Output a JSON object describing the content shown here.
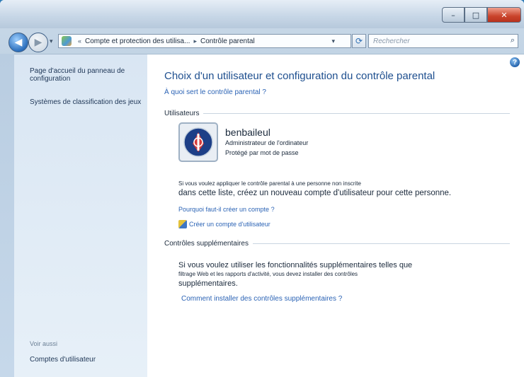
{
  "address": {
    "crumb1": "Compte et protection des utilisa...",
    "crumb2": "Contrôle parental"
  },
  "search": {
    "placeholder": "Rechercher"
  },
  "sidebar": {
    "link1": "Page d'accueil du panneau de configuration",
    "link2": "Systèmes de classification des jeux",
    "see_also": "Voir aussi",
    "accounts": "Comptes d'utilisateur"
  },
  "main": {
    "title": "Choix d'un utilisateur et configuration du contrôle parental",
    "what_link": "À quoi sert le contrôle parental ?",
    "users_header": "Utilisateurs",
    "user": {
      "name": "benbaileul",
      "role": "Administrateur de l'ordinateur",
      "protection": "Protégé par mot de passe"
    },
    "add_small": "Si vous voulez appliquer le contrôle parental à une personne non inscrite",
    "add_large": "dans cette liste, créez un nouveau compte d'utilisateur pour cette personne.",
    "why_link": "Pourquoi faut-il créer un compte ?",
    "create_link": "Créer un compte d'utilisateur",
    "extra_header": "Contrôles supplémentaires",
    "extra_line1": "Si vous voulez utiliser les fonctionnalités supplémentaires telles que",
    "extra_line2": "filtrage Web et les rapports d'activité, vous devez installer des contrôles",
    "extra_line3": "supplémentaires.",
    "extra_link": "Comment installer des contrôles supplémentaires ?"
  },
  "icons": {
    "back": "back-arrow-icon",
    "forward": "forward-arrow-icon",
    "refresh": "refresh-icon",
    "search": "search-icon",
    "help": "help-icon",
    "avatar": "user-avatar-icon",
    "create": "shield-icon"
  },
  "colors": {
    "link": "#2b63b5",
    "heading": "#1e4f8f",
    "close_button": "#c9432b"
  }
}
